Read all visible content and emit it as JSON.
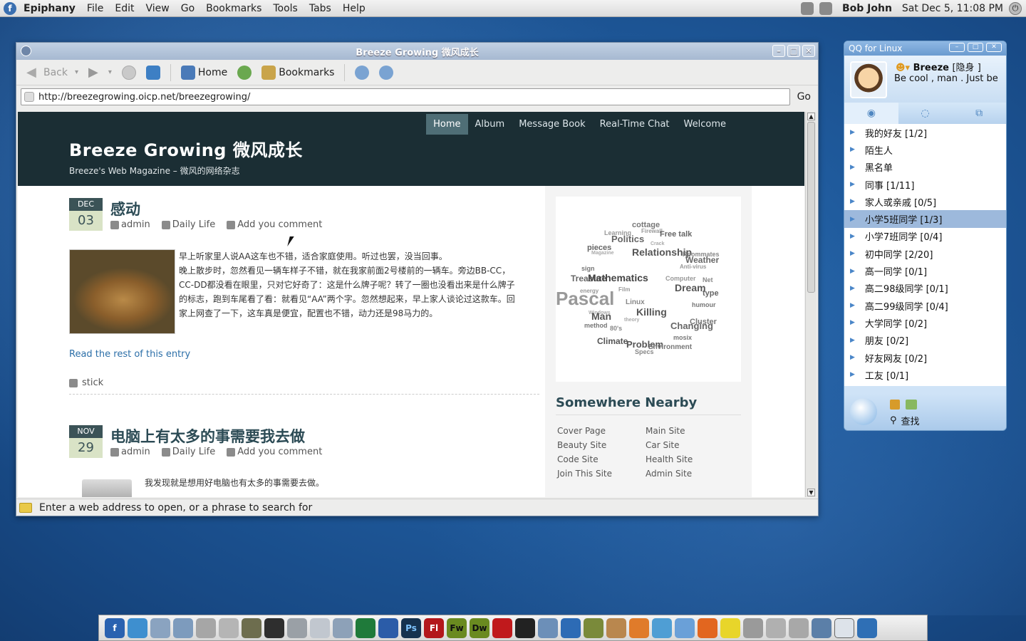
{
  "topbar": {
    "app": "Epiphany",
    "menus": [
      "File",
      "Edit",
      "View",
      "Go",
      "Bookmarks",
      "Tools",
      "Tabs",
      "Help"
    ],
    "user": "Bob John",
    "clock": "Sat Dec  5, 11:08 PM"
  },
  "browser": {
    "title": "Breeze Growing 微风成长",
    "back": "Back",
    "home": "Home",
    "bookmarks": "Bookmarks",
    "url": "http://breezegrowing.oicp.net/breezegrowing/",
    "go": "Go",
    "status": "Enter a web address to open, or a phrase to search for"
  },
  "site": {
    "title": "Breeze Growing 微风成长",
    "desc": "Breeze's Web Magazine – 微风的网络杂志",
    "nav": [
      "Home",
      "Album",
      "Message Book",
      "Real-Time Chat",
      "Welcome"
    ]
  },
  "posts": [
    {
      "month": "DEC",
      "day": "03",
      "title": "感动",
      "author": "admin",
      "category": "Daily Life",
      "comments": "Add you comment",
      "body": "早上听家里人说AA这车也不错，适合家庭使用。听过也罢，没当回事。\n晚上散步时，忽然看见一辆车样子不错，就在我家前面2号楼前的一辆车。旁边BB-CC，CC-DD都没看在眼里，只对它好奇了：这是什么牌子呢？转了一圈也没看出来是什么牌子的标志，跑到车尾看了看：就看见“AA”两个字。忽然想起来，早上家人谈论过这款车。回家上网查了一下，这车真是便宜，配置也不错，动力还是98马力的。",
      "readmore": "Read the rest of this entry",
      "tag": "stick"
    },
    {
      "month": "NOV",
      "day": "29",
      "title": "电脑上有太多的事需要我去做",
      "author": "admin",
      "category": "Daily Life",
      "comments": "Add you comment",
      "body": "我发现就是想用好电脑也有太多的事需要去做。"
    }
  ],
  "cloud_words": [
    "cottage",
    "Learning",
    "Firewall",
    "Free talk",
    "Politics",
    "Crack",
    "pieces",
    "Magazine",
    "Relationship",
    "Roommates",
    "Weather",
    "sign",
    "Treasure",
    "Mathematics",
    "Computer",
    "Anti-virus",
    "energy",
    "Film",
    "Dream",
    "Net",
    "type",
    "Pascal",
    "Linux",
    "Killing",
    "humour",
    "Windows",
    "Man",
    "Cluster",
    "method",
    "80's",
    "theory",
    "Changing",
    "Climate",
    "Problem",
    "mosix",
    "Environment",
    "Specs"
  ],
  "sidebar": {
    "heading": "Somewhere Nearby",
    "links": [
      "Cover Page",
      "Main Site",
      "Beauty Site",
      "Car Site",
      "Code Site",
      "Health Site",
      "Join This Site",
      "Admin Site"
    ]
  },
  "qq": {
    "title": "QQ for Linux",
    "name": "Breeze",
    "status": "[隐身 ]",
    "signature": "Be cool , man . Just be",
    "groups": [
      "我的好友 [1/2]",
      "陌生人",
      "黑名单",
      "同事 [1/11]",
      "家人或亲戚 [0/5]",
      "小学5班同学 [1/3]",
      "小学7班同学 [0/4]",
      "初中同学 [2/20]",
      "高一同学 [0/1]",
      "高二98级同学 [0/1]",
      "高二99级同学 [0/4]",
      "大学同学 [0/2]",
      "朋友 [0/2]",
      "好友网友  [0/2]",
      "工友 [0/1]"
    ],
    "selected_group": "小学5班同学 [1/3]",
    "find": "查找"
  },
  "dock": [
    "Ps",
    "Fl",
    "Fw",
    "Dw"
  ]
}
